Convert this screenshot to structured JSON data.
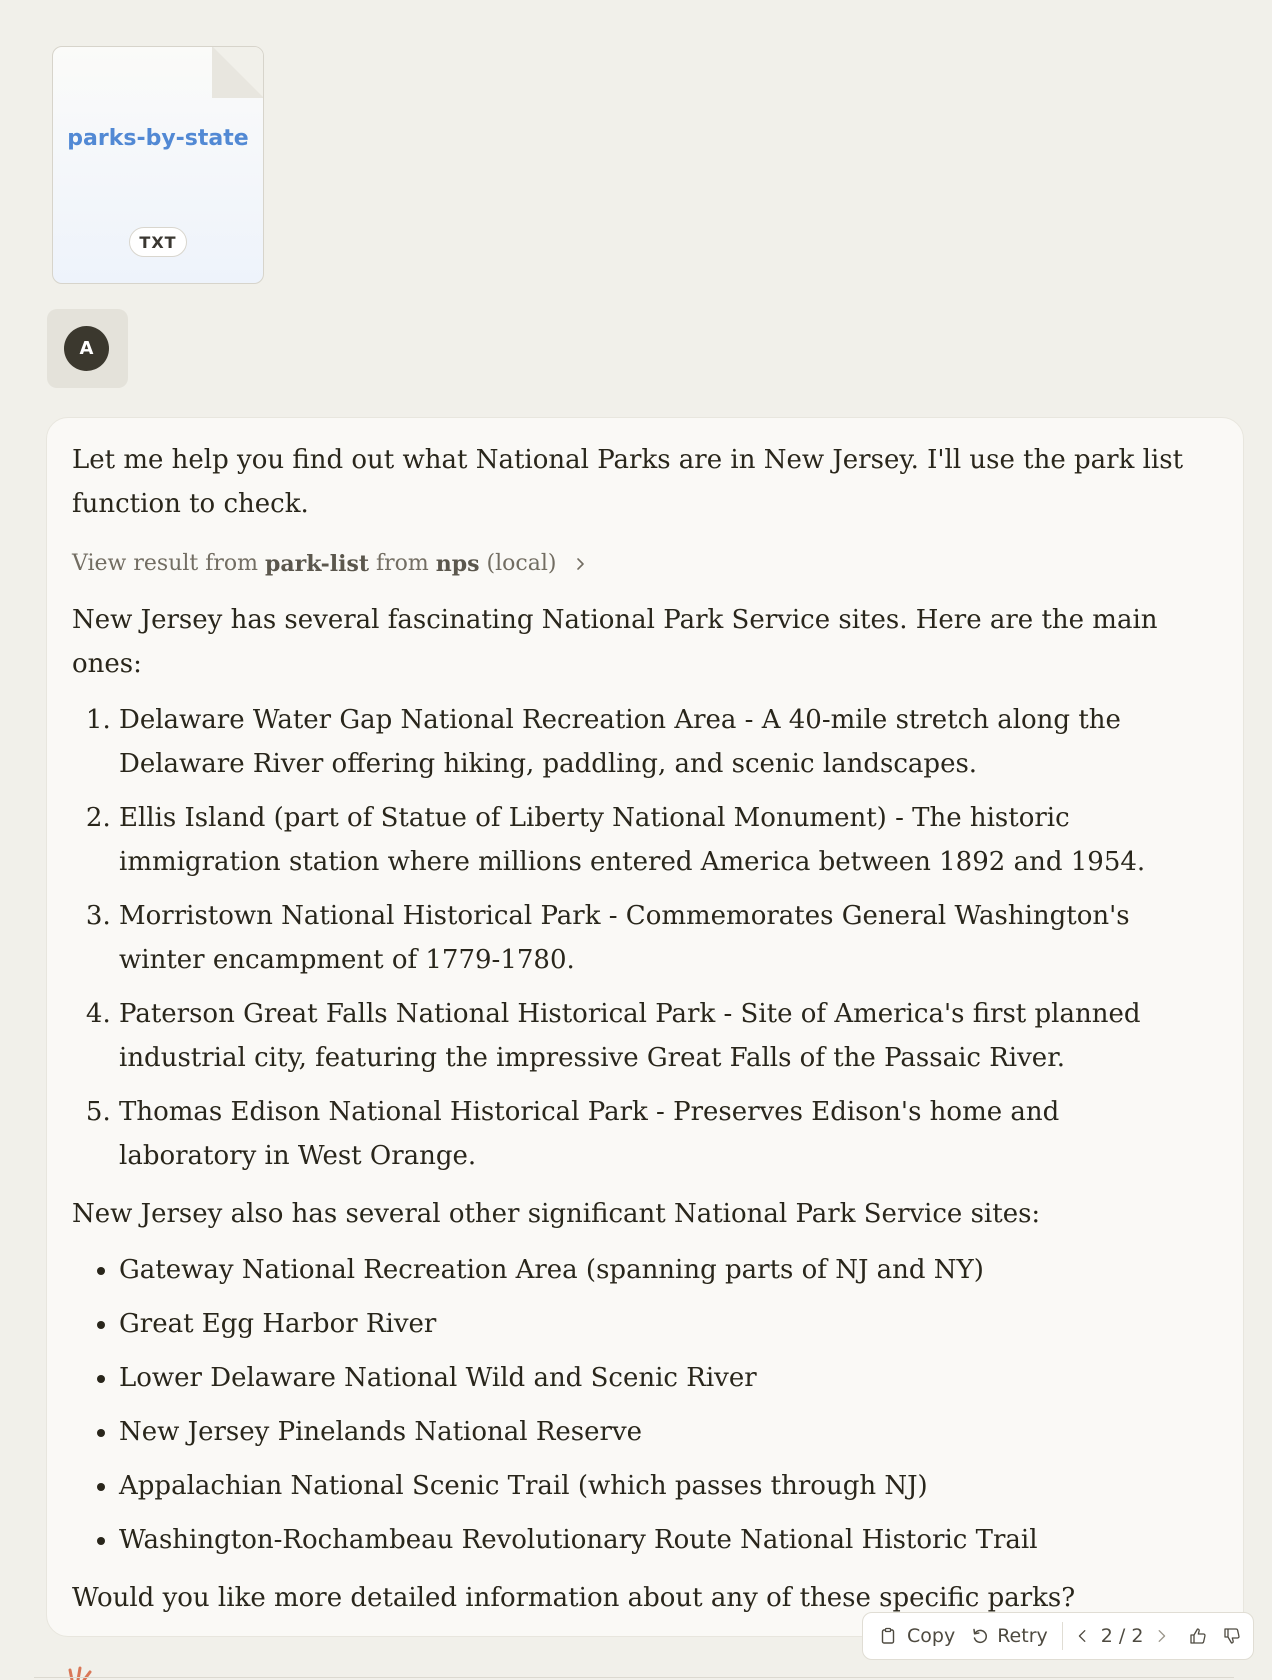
{
  "attachment": {
    "name": "parks-by-state",
    "type_badge": "TXT"
  },
  "user": {
    "avatar_initial": "A"
  },
  "response": {
    "intro": "Let me help you find out what National Parks are in New Jersey. I'll use the park list function to check.",
    "tool_result": {
      "prefix": "View result from",
      "tool": "park-list",
      "from_word": "from",
      "server": "nps",
      "suffix": "(local)"
    },
    "main_intro": "New Jersey has several fascinating National Park Service sites. Here are the main ones:",
    "main_parks": [
      "Delaware Water Gap National Recreation Area - A 40-mile stretch along the Delaware River offering hiking, paddling, and scenic landscapes.",
      "Ellis Island (part of Statue of Liberty National Monument) - The historic immigration station where millions entered America between 1892 and 1954.",
      "Morristown National Historical Park - Commemorates General Washington's winter encampment of 1779-1780.",
      "Paterson Great Falls National Historical Park - Site of America's first planned industrial city, featuring the impressive Great Falls of the Passaic River.",
      "Thomas Edison National Historical Park - Preserves Edison's home and laboratory in West Orange."
    ],
    "other_intro": "New Jersey also has several other significant National Park Service sites:",
    "other_sites": [
      "Gateway National Recreation Area (spanning parts of NJ and NY)",
      "Great Egg Harbor River",
      "Lower Delaware National Wild and Scenic River",
      "New Jersey Pinelands National Reserve",
      "Appalachian National Scenic Trail (which passes through NJ)",
      "Washington-Rochambeau Revolutionary Route National Historic Trail"
    ],
    "closing": "Would you like more detailed information about any of these specific parks?"
  },
  "actions": {
    "copy_label": "Copy",
    "retry_label": "Retry",
    "pager": "2 / 2"
  },
  "colors": {
    "background": "#f1f0ea",
    "panel": "#faf9f6",
    "file_name": "#5289d4",
    "avatar": "#3b382e",
    "text": "#29261b",
    "muted": "#726d62",
    "brand_mark": "#d97757"
  }
}
